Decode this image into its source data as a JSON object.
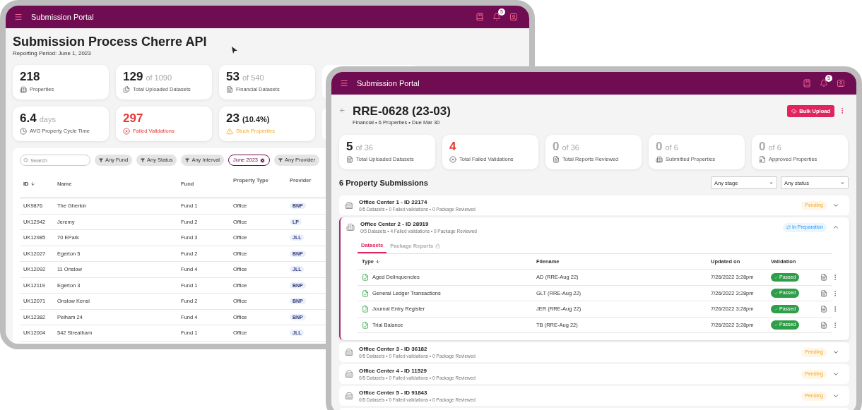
{
  "back_window": {
    "app_title": "Submission Portal",
    "notification_count": "5",
    "page_title": "Submission Process Cherre API",
    "reporting_period": "Reporting Period: June 1, 2023",
    "stats": [
      {
        "value": "218",
        "label": "Properties",
        "kind": "neutral"
      },
      {
        "value": "129",
        "suffix": "of 1090",
        "label": "Total Uploaded Datasets",
        "kind": "neutral"
      },
      {
        "value": "53",
        "suffix": "of 540",
        "label": "Financial Datasets",
        "kind": "neutral"
      },
      {
        "value": "6.4",
        "suffix": "days",
        "label": "AVG Property Cycle Time",
        "kind": "neutral"
      },
      {
        "value": "297",
        "label": "Failed Validations",
        "kind": "error"
      },
      {
        "value": "23",
        "suffix": "(10.4%)",
        "label": "Stuck Properties",
        "kind": "warning"
      }
    ],
    "search": {
      "placeholder": "Search"
    },
    "filters": [
      {
        "label": "Any Fund",
        "selected": false
      },
      {
        "label": "Any Status",
        "selected": false
      },
      {
        "label": "Any Interval",
        "selected": false
      },
      {
        "label": "June 2023",
        "selected": true
      },
      {
        "label": "Any Provider",
        "selected": false
      }
    ],
    "table": {
      "columns": [
        "ID",
        "Name",
        "Fund",
        "Property Type",
        "Provider"
      ],
      "rows": [
        {
          "id": "UK9876",
          "name": "The Gherkin",
          "fund": "Fund 1",
          "type": "Office",
          "provider": "BNP"
        },
        {
          "id": "UK12942",
          "name": "Jeremy",
          "fund": "Fund 2",
          "type": "Office",
          "provider": "LP"
        },
        {
          "id": "UK12985",
          "name": "70 EPark",
          "fund": "Fund 3",
          "type": "Office",
          "provider": "JLL"
        },
        {
          "id": "UK12027",
          "name": "Egerton 5",
          "fund": "Fund 2",
          "type": "Office",
          "provider": "BNP"
        },
        {
          "id": "UK12092",
          "name": "11 Onslow",
          "fund": "Fund 4",
          "type": "Office",
          "provider": "JLL"
        },
        {
          "id": "UK12119",
          "name": "Egerton 3",
          "fund": "Fund 1",
          "type": "Office",
          "provider": "BNP"
        },
        {
          "id": "UK12071",
          "name": "Onslow Kensi",
          "fund": "Fund 2",
          "type": "Office",
          "provider": "BNP"
        },
        {
          "id": "UK12382",
          "name": "Pelham 24",
          "fund": "Fund 4",
          "type": "Office",
          "provider": "BNP"
        },
        {
          "id": "UK12004",
          "name": "542 Streatham",
          "fund": "Fund 1",
          "type": "Office",
          "provider": "JLL"
        }
      ]
    }
  },
  "front_window": {
    "app_title": "Submission Portal",
    "notification_count": "5",
    "title": "RRE-0628 (23-03)",
    "subtitle": "Financial • 6 Properties • Due Mar 30",
    "bulk_upload": "Bulk Upload",
    "stats": [
      {
        "value": "5",
        "suffix": "of 36",
        "label": "Total Uploaded Datasets",
        "kind": "neutral"
      },
      {
        "value": "4",
        "label": "Total Failed Validations",
        "kind": "error"
      },
      {
        "value": "0",
        "suffix": "of 36",
        "label": "Total Reports Reviewed",
        "kind": "empty"
      },
      {
        "value": "0",
        "suffix": "of 6",
        "label": "Submitted Properties",
        "kind": "empty"
      },
      {
        "value": "0",
        "suffix": "of 6",
        "label": "Approved Properties",
        "kind": "empty"
      }
    ],
    "section_title": "6 Property Submissions",
    "stage_select": "Any stage",
    "status_select": "Any status",
    "submissions": [
      {
        "title": "Office Center 1 - ID 22174",
        "summary": "0/5 Datasets • 0 Failed validations • 0 Package Reviewed",
        "status": "Pending",
        "kind": "pending",
        "expanded": false
      },
      {
        "title": "Office Center 2 - ID 28919",
        "summary": "0/5 Datasets • 4 Failed validations • 0 Package Reviewed",
        "status": "In Preparation",
        "kind": "preparation",
        "expanded": true,
        "tabs": [
          {
            "label": "Datasets",
            "selected": true,
            "locked": false
          },
          {
            "label": "Package Reports",
            "selected": false,
            "locked": true
          }
        ],
        "columns": [
          "Type",
          "Filename",
          "Updated on",
          "Validation"
        ],
        "datasets": [
          {
            "type": "Aged Delinquencies",
            "filename": "AD (RRE-Aug 22)",
            "updated": "7/26/2022 3:28pm",
            "validation": "Passed"
          },
          {
            "type": "General Ledger Transactions",
            "filename": "GLT (RRE-Aug 22)",
            "updated": "7/26/2022 3:28pm",
            "validation": "Passed"
          },
          {
            "type": "Journal Entry Register",
            "filename": "JER (RRE-Aug 22)",
            "updated": "7/26/2022 3:28pm",
            "validation": "Passed"
          },
          {
            "type": "Trial Balance",
            "filename": "TB (RRE-Aug 22)",
            "updated": "7/26/2022 3:28pm",
            "validation": "Passed"
          }
        ]
      },
      {
        "title": "Office Center 3 - ID 36182",
        "summary": "0/5 Datasets • 0 Failed validations • 0 Package Reviewed",
        "status": "Pending",
        "kind": "pending",
        "expanded": false
      },
      {
        "title": "Office Center 4 - ID 11529",
        "summary": "0/5 Datasets • 0 Failed validations • 0 Package Reviewed",
        "status": "Pending",
        "kind": "pending",
        "expanded": false
      },
      {
        "title": "Office Center 5 - ID 91843",
        "summary": "0/5 Datasets • 0 Failed validations • 0 Package Reviewed",
        "status": "Pending",
        "kind": "pending",
        "expanded": false
      }
    ]
  }
}
